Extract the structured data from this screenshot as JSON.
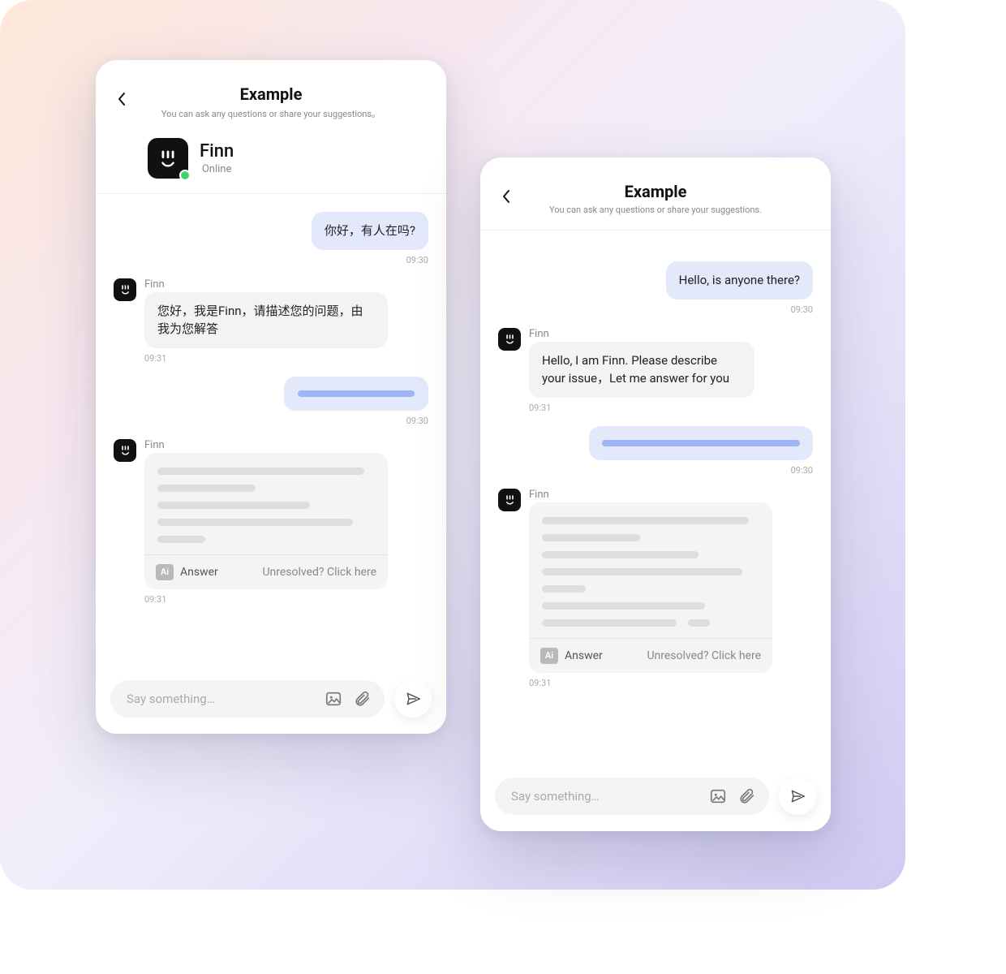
{
  "header": {
    "title": "Example",
    "subtitle_cn": "You can ask any questions or share your suggestions。",
    "subtitle_en": "You can ask any questions or share your suggestions.",
    "agent_name": "Finn",
    "agent_status": "Online"
  },
  "ai": {
    "badge": "Ai",
    "answer_label": "Answer",
    "unresolved_label": "Unresolved? Click here"
  },
  "composer": {
    "placeholder": "Say something…"
  },
  "left_chat": {
    "messages": [
      {
        "side": "user",
        "text": "你好，有人在吗?",
        "time": "09:30"
      },
      {
        "side": "agent",
        "sender": "Finn",
        "text": "您好，我是Finn，请描述您的问题，由我为您解答",
        "time": "09:31"
      },
      {
        "side": "user_loading",
        "time": "09:30"
      },
      {
        "side": "agent_ai",
        "sender": "Finn",
        "time": "09:31"
      }
    ]
  },
  "right_chat": {
    "messages": [
      {
        "side": "user",
        "text": "Hello, is anyone there?",
        "time": "09:30"
      },
      {
        "side": "agent",
        "sender": "Finn",
        "text": "Hello, I am Finn. Please describe your issue，Let me answer for you",
        "time": "09:31"
      },
      {
        "side": "user_loading",
        "time": "09:30"
      },
      {
        "side": "agent_ai",
        "sender": "Finn",
        "time": "09:31"
      }
    ]
  }
}
